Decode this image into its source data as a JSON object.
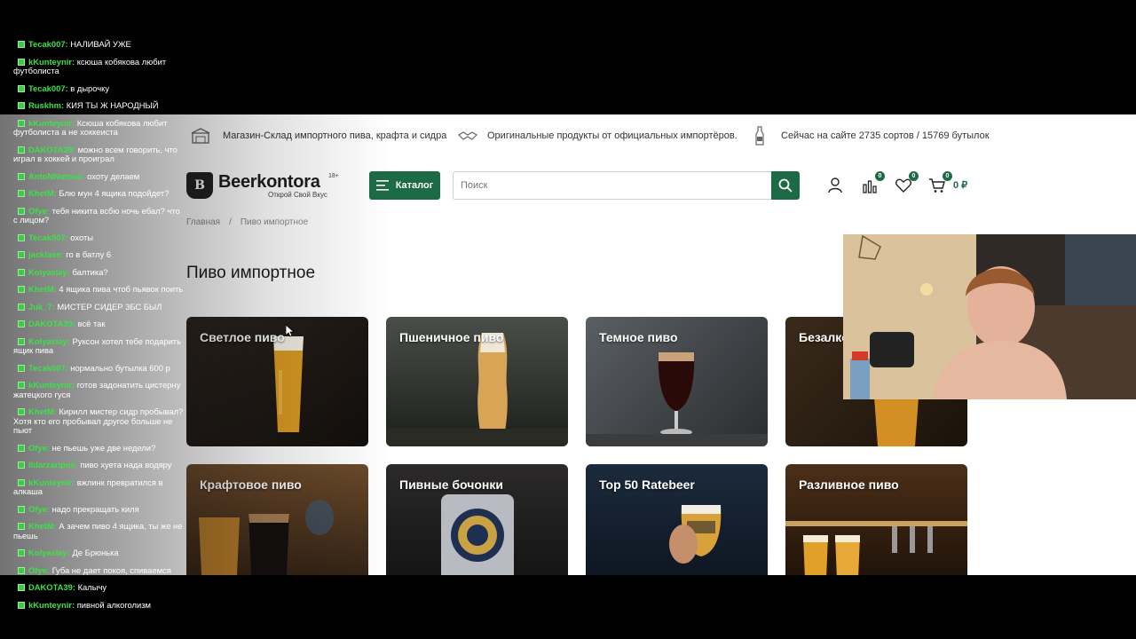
{
  "site": {
    "topbar": {
      "item1": "Магазин-Склад импортного пива, крафта и сидра",
      "item2": "Оригинальные продукты от официальных импортёров.",
      "item3": "Сейчас на сайте 2735 сортов / 15769 бутылок"
    },
    "logo": {
      "name": "Beerkontora",
      "slogan": "Открой Свой Вкус",
      "age": "18+"
    },
    "catalog_label": "Каталог",
    "search_placeholder": "Поиск",
    "compare_count": "0",
    "favorites_count": "0",
    "cart_count": "0",
    "cart_sum": "0 ₽",
    "breadcrumb": {
      "home": "Главная",
      "sep": "/",
      "current": "Пиво импортное"
    },
    "page_title": "Пиво импортное",
    "categories": [
      {
        "label": "Светлое пиво"
      },
      {
        "label": "Пшеничное пиво"
      },
      {
        "label": "Темное пиво"
      },
      {
        "label": "Безалкогольное пиво"
      },
      {
        "label": "Крафтовое пиво"
      },
      {
        "label": "Пивные бочонки"
      },
      {
        "label": "Top 50 Ratebeer"
      },
      {
        "label": "Разливное пиво"
      }
    ],
    "colors": {
      "accent": "#1c6b46"
    }
  },
  "chat": [
    {
      "user": "Tecak007",
      "text": "НАЛИВАЙ УЖЕ"
    },
    {
      "user": "kKunteynir",
      "text": "ксюша кобякова любит футболиста"
    },
    {
      "user": "Tecak007",
      "text": "в дырочку"
    },
    {
      "user": "Ruskhm",
      "text": "КИЯ ТЫ Ж НАРОДНЫЙ"
    },
    {
      "user": "kKunteynir",
      "text": "Ксюша кобякова любит футболиста а не хоккеиста"
    },
    {
      "user": "DAKOTA39",
      "text": "можно всем говорить, что играл в хоккей и проиграл"
    },
    {
      "user": "AntoNNotona",
      "text": "охоту делаем"
    },
    {
      "user": "KhetM",
      "text": "Блю мун 4 ящика подойдет?"
    },
    {
      "user": "Ofye",
      "text": "тебя никита всбю ночь ебал? что с лицом?"
    },
    {
      "user": "Tecak007",
      "text": "охоты"
    },
    {
      "user": "jacklass",
      "text": "го в батлу 6"
    },
    {
      "user": "Kolyaslay",
      "text": "балтика?"
    },
    {
      "user": "KhetM",
      "text": "4 ящика пива чтоб пьявок поить"
    },
    {
      "user": "Juk_7",
      "text": "МИСТЕР СИДЕР 3БС БЫЛ"
    },
    {
      "user": "DAKOTA39",
      "text": "всё так"
    },
    {
      "user": "Kolyaslay",
      "text": "Руксон хотел тебе подарить ящик пива"
    },
    {
      "user": "Tecak007",
      "text": "нормально бутылка 600 р"
    },
    {
      "user": "kKunteynir",
      "text": "готов задонатить цистерну жатецкого гуся"
    },
    {
      "user": "KhetM",
      "text": "Кирилл мистер сидр пробывал? Хотя кто его пробывал другое больше не пьют"
    },
    {
      "user": "Ofye",
      "text": "не пьешь уже две недели?"
    },
    {
      "user": "Ildarzaripov",
      "text": "пиво хуета нада водяру"
    },
    {
      "user": "kKunteynir",
      "text": "вжлинк превратился в алкаша"
    },
    {
      "user": "Ofye",
      "text": "надо прекращать киля"
    },
    {
      "user": "KhetM",
      "text": "А зачем пиво 4 ящика, ты же не пьешь"
    },
    {
      "user": "Kolyaslay",
      "text": "Де Брюнька"
    },
    {
      "user": "Ofye",
      "text": "Губа не дает покоя, спиваемся"
    },
    {
      "user": "DAKOTA39",
      "text": "Калычу"
    },
    {
      "user": "kKunteynir",
      "text": "пивной алкоголизм"
    }
  ]
}
